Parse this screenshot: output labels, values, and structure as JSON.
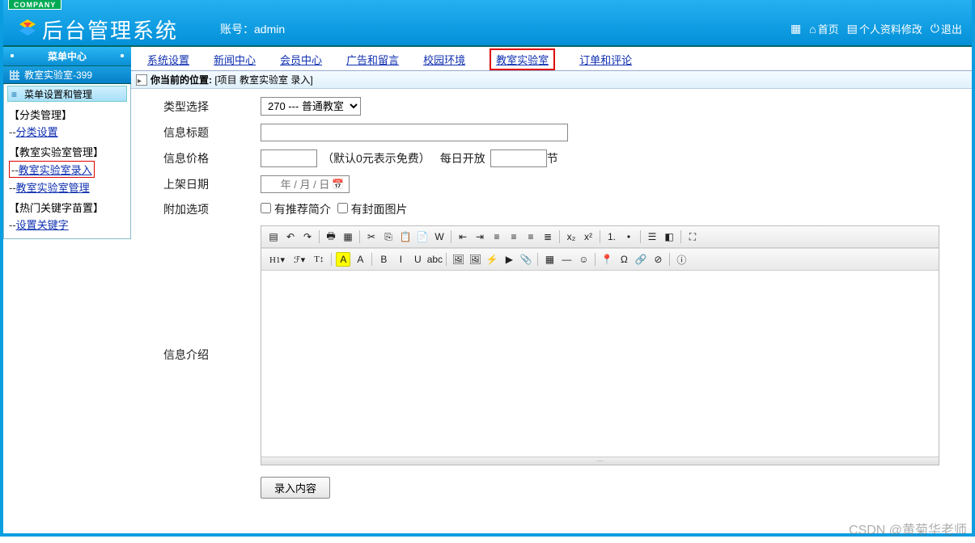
{
  "header": {
    "company_tag": "COMPANY",
    "system_title": "后台管理系统",
    "account_label": "账号：",
    "account_value": "admin",
    "home": "首页",
    "profile": "个人资料修改",
    "logout": "退出"
  },
  "sidebar": {
    "menu_center": "菜单中心",
    "module_title": "教室实验室-399",
    "section_title": "菜单设置和管理",
    "groups": [
      {
        "title": "【分类管理】",
        "items": [
          {
            "label": "分类设置",
            "active": false
          }
        ]
      },
      {
        "title": "【教室实验室管理】",
        "items": [
          {
            "label": "教室实验室录入",
            "active": true
          },
          {
            "label": "教室实验室管理",
            "active": false
          }
        ]
      },
      {
        "title": "【热门关键字苗置】",
        "items": [
          {
            "label": "设置关键字",
            "active": false
          }
        ]
      }
    ]
  },
  "tabs": [
    {
      "label": "系统设置",
      "active": false
    },
    {
      "label": "新闻中心",
      "active": false
    },
    {
      "label": "会员中心",
      "active": false
    },
    {
      "label": "广告和留言",
      "active": false
    },
    {
      "label": "校园环境",
      "active": false
    },
    {
      "label": "教室实验室",
      "active": true
    },
    {
      "label": "订单和评论",
      "active": false
    }
  ],
  "breadcrumb": {
    "label": "你当前的位置:",
    "path": "[项目 教室实验室 录入]"
  },
  "form": {
    "type_label": "类型选择",
    "type_value": "270 --- 普通教室",
    "title_label": "信息标题",
    "title_value": "",
    "price_label": "信息价格",
    "price_value": "",
    "price_hint": "（默认0元表示免费）",
    "daily_open": "每日开放",
    "slot_value": "",
    "slot_unit": "节",
    "date_label": "上架日期",
    "date_placeholder": "年 / 月 / 日",
    "addon_label": "附加选项",
    "addon_rec": "有推荐简介",
    "addon_cover": "有封面图片",
    "intro_label": "信息介绍",
    "submit": "录入内容"
  },
  "editor_toolbar_row1": [
    {
      "n": "source-icon",
      "g": "▤"
    },
    {
      "n": "undo-icon",
      "g": "↶"
    },
    {
      "n": "redo-icon",
      "g": "↷"
    },
    {
      "sep": true
    },
    {
      "n": "print-icon",
      "g": "🖶"
    },
    {
      "n": "template-icon",
      "g": "▦"
    },
    {
      "sep": true
    },
    {
      "n": "cut-icon",
      "g": "✂"
    },
    {
      "n": "copy-icon",
      "g": "⎘"
    },
    {
      "n": "paste-icon",
      "g": "📋"
    },
    {
      "n": "paste-text-icon",
      "g": "📄"
    },
    {
      "n": "paste-word-icon",
      "g": "W"
    },
    {
      "sep": true
    },
    {
      "n": "outdent-icon",
      "g": "⇤"
    },
    {
      "n": "indent-icon",
      "g": "⇥"
    },
    {
      "n": "align-left-icon",
      "g": "≡"
    },
    {
      "n": "align-center-icon",
      "g": "≡"
    },
    {
      "n": "align-right-icon",
      "g": "≡"
    },
    {
      "n": "justify-icon",
      "g": "≣"
    },
    {
      "sep": true
    },
    {
      "n": "sub-icon",
      "g": "x₂"
    },
    {
      "n": "sup-icon",
      "g": "x²"
    },
    {
      "sep": true
    },
    {
      "n": "ol-icon",
      "g": "1."
    },
    {
      "n": "ul-icon",
      "g": "•"
    },
    {
      "sep": true
    },
    {
      "n": "select-all-icon",
      "g": "☰"
    },
    {
      "n": "eraser-icon",
      "g": "◧"
    },
    {
      "sep": true
    },
    {
      "n": "fullscreen-icon",
      "g": "⛶"
    }
  ],
  "editor_toolbar_row2": [
    {
      "n": "heading-select",
      "g": "H1▾",
      "wide": true
    },
    {
      "n": "font-select",
      "g": "ℱ▾",
      "wide": true
    },
    {
      "n": "size-select",
      "g": "T↕",
      "wide": true
    },
    {
      "sep": true
    },
    {
      "n": "color-icon",
      "g": "A",
      "cls": "hilite"
    },
    {
      "n": "bgcolor-icon",
      "g": "A"
    },
    {
      "sep": true
    },
    {
      "n": "bold-icon",
      "g": "B"
    },
    {
      "n": "italic-icon",
      "g": "I"
    },
    {
      "n": "underline-icon",
      "g": "U"
    },
    {
      "n": "strike-icon",
      "g": "abc"
    },
    {
      "sep": true
    },
    {
      "n": "image-icon",
      "g": "🖼"
    },
    {
      "n": "multi-image-icon",
      "g": "🖼"
    },
    {
      "n": "flash-icon",
      "g": "⚡"
    },
    {
      "n": "media-icon",
      "g": "▶"
    },
    {
      "n": "file-icon",
      "g": "📎"
    },
    {
      "sep": true
    },
    {
      "n": "table-icon",
      "g": "▦"
    },
    {
      "n": "hr-icon",
      "g": "—"
    },
    {
      "n": "emoji-icon",
      "g": "☺"
    },
    {
      "sep": true
    },
    {
      "n": "map-icon",
      "g": "📍"
    },
    {
      "n": "char-icon",
      "g": "Ω"
    },
    {
      "n": "link-icon",
      "g": "🔗"
    },
    {
      "n": "unlink-icon",
      "g": "⊘"
    },
    {
      "sep": true
    },
    {
      "n": "about-icon",
      "g": "ⓘ"
    }
  ],
  "watermark": "CSDN @黄菊华老师"
}
